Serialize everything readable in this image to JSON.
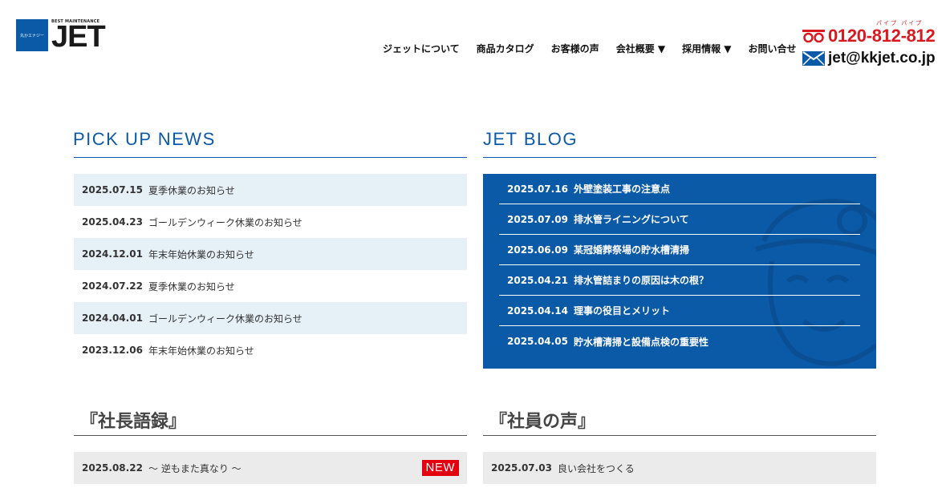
{
  "header": {
    "logo_tagline": "BEST MAINTENANCE",
    "logo_sub": "丸かエナジー",
    "logo_text": "JET",
    "nav": [
      {
        "label": "ジェットについて"
      },
      {
        "label": "商品カタログ"
      },
      {
        "label": "お客様の声"
      },
      {
        "label": "会社概要 ▼"
      },
      {
        "label": "採用情報 ▼"
      },
      {
        "label": "お問い合せ"
      }
    ],
    "phone_ruby": "パイプ パイプ",
    "phone": "0120-812-812",
    "email": "jet@kkjet.co.jp"
  },
  "pickup": {
    "title": "PICK UP NEWS",
    "items": [
      {
        "date": "2025.07.15",
        "text": "夏季休業のお知らせ"
      },
      {
        "date": "2025.04.23",
        "text": "ゴールデンウィーク休業のお知らせ"
      },
      {
        "date": "2024.12.01",
        "text": "年末年始休業のお知らせ"
      },
      {
        "date": "2024.07.22",
        "text": "夏季休業のお知らせ"
      },
      {
        "date": "2024.04.01",
        "text": "ゴールデンウィーク休業のお知らせ"
      },
      {
        "date": "2023.12.06",
        "text": "年末年始休業のお知らせ"
      }
    ]
  },
  "blog": {
    "title": "JET BLOG",
    "items": [
      {
        "date": "2025.07.16",
        "text": "外壁塗装工事の注意点"
      },
      {
        "date": "2025.07.09",
        "text": "排水管ライニングについて"
      },
      {
        "date": "2025.06.09",
        "text": "某冠婚葬祭場の貯水槽清掃"
      },
      {
        "date": "2025.04.21",
        "text": "排水管詰まりの原因は木の根？"
      },
      {
        "date": "2025.04.14",
        "text": "理事の役目とメリット"
      },
      {
        "date": "2025.04.05",
        "text": "貯水槽清掃と設備点検の重要性"
      }
    ]
  },
  "president": {
    "title": "『社長語録』",
    "date": "2025.08.22",
    "text": "～ 逆もまた真なり ～",
    "badge": "NEW"
  },
  "staff": {
    "title": "『社員の声』",
    "date": "2025.07.03",
    "text": "良い会社をつくる"
  },
  "colors": {
    "brand_blue": "#0b5aa8",
    "phone_red": "#d9191f",
    "news_shade": "#e6f0f7",
    "badge_red": "#e3000f"
  }
}
